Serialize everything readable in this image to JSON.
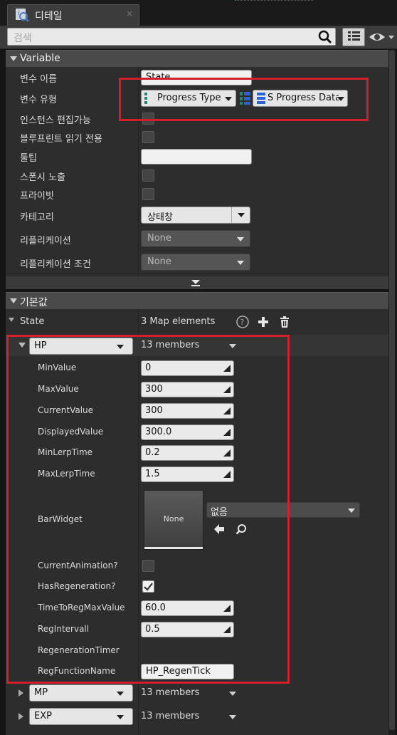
{
  "tab": {
    "title": "디테일",
    "close": "×"
  },
  "search": {
    "placeholder": "검색"
  },
  "variable": {
    "header": "Variable",
    "name_label": "변수 이름",
    "name_value": "State",
    "type_label": "변수 유형",
    "type_key": "Progress Type",
    "type_value": "S Progress Data",
    "instance_editable_label": "인스턴스 편집가능",
    "blueprint_readonly_label": "블루프린트 읽기 전용",
    "tooltip_label": "툴팁",
    "expose_on_spawn_label": "스폰시 노출",
    "private_label": "프라이빗",
    "category_label": "카테고리",
    "category_value": "상태창",
    "replication_label": "리플리케이션",
    "replication_value": "None",
    "replication_condition_label": "리플리케이션 조건",
    "replication_condition_value": "None"
  },
  "defaults": {
    "header": "기본값",
    "state_label": "State",
    "state_value": "3 Map elements",
    "entries": [
      {
        "key": "HP",
        "members": "13 members"
      },
      {
        "key": "MP",
        "members": "13 members"
      },
      {
        "key": "EXP",
        "members": "13 members"
      }
    ],
    "hp_fields": {
      "min_value": {
        "label": "MinValue",
        "value": "0"
      },
      "max_value": {
        "label": "MaxValue",
        "value": "300"
      },
      "current_value": {
        "label": "CurrentValue",
        "value": "300"
      },
      "displayed_value": {
        "label": "DisplayedValue",
        "value": "300.0"
      },
      "min_lerp_time": {
        "label": "MinLerpTime",
        "value": "0.2"
      },
      "max_lerp_time": {
        "label": "MaxLerpTime",
        "value": "1.5"
      },
      "bar_widget": {
        "label": "BarWidget",
        "thumb": "None",
        "value": "없음"
      },
      "current_animation": {
        "label": "CurrentAnimation?"
      },
      "has_regeneration": {
        "label": "HasRegeneration?",
        "checked": true
      },
      "time_to_reg": {
        "label": "TimeToRegMaxValue",
        "value": "60.0"
      },
      "reg_interval": {
        "label": "RegIntervall",
        "value": "0.5"
      },
      "regeneration_timer": {
        "label": "RegenerationTimer"
      },
      "reg_function_name": {
        "label": "RegFunctionName",
        "value": "HP_RegenTick"
      }
    }
  },
  "colors": {
    "highlight_box": "#d2202a",
    "panel_bg": "#2d2d2d",
    "header_bg": "#4a4a4a",
    "type_icon_key": "#1f8a74",
    "type_icon_value": "#2a63d8"
  },
  "icons": {
    "tab": "details-magnifier-icon",
    "search": "search-icon",
    "view_options": "eye-icon",
    "property_matrix": "grid-icon",
    "help": "question-icon",
    "add": "plus-icon",
    "delete": "trash-icon",
    "browse": "back-arrow-icon",
    "find": "magnifier-icon"
  }
}
